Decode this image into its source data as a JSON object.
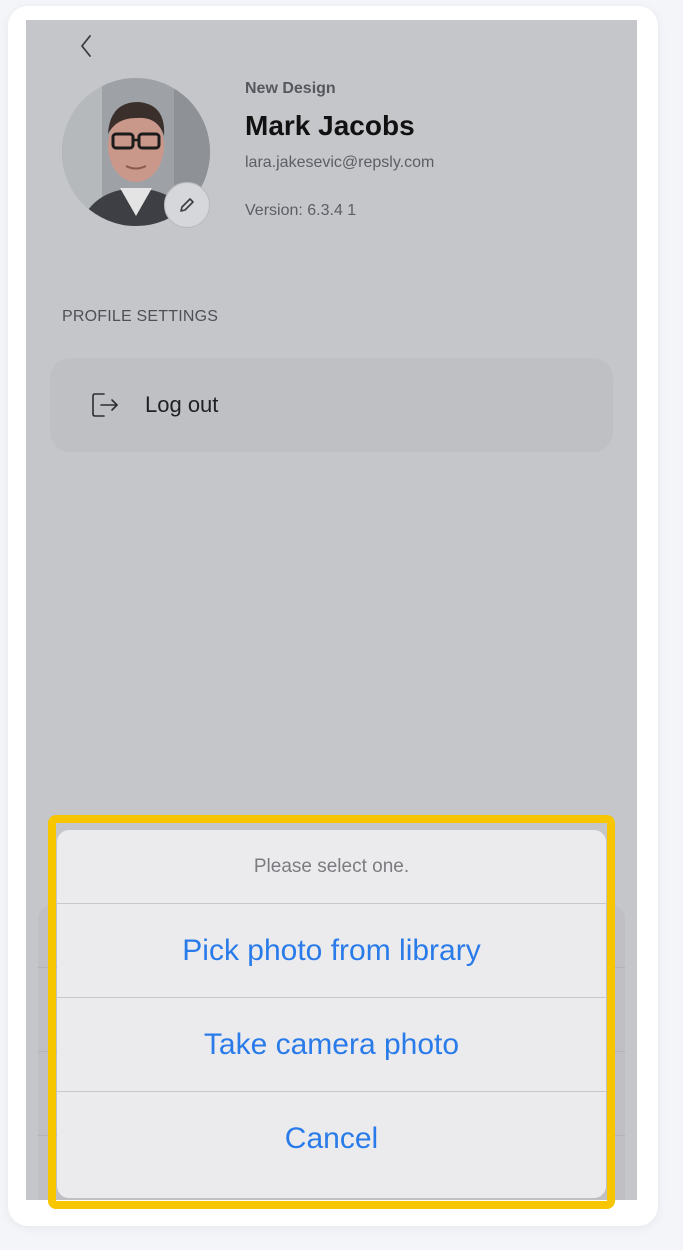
{
  "header": {
    "back_icon": "chevron-left-icon"
  },
  "profile": {
    "company": "New Design",
    "name": "Mark Jacobs",
    "email": "lara.jakesevic@repsly.com",
    "version": "Version: 6.3.4 1",
    "edit_icon": "pencil-icon"
  },
  "settings": {
    "section_title": "PROFILE SETTINGS",
    "logout_label": "Log out",
    "logout_icon": "logout-icon"
  },
  "action_sheet": {
    "title": "Please select one.",
    "options": [
      {
        "label": "Pick photo from library"
      },
      {
        "label": "Take camera photo"
      },
      {
        "label": "Cancel"
      }
    ],
    "option_color": "#2a7bea",
    "highlight_color": "#f7c600"
  }
}
